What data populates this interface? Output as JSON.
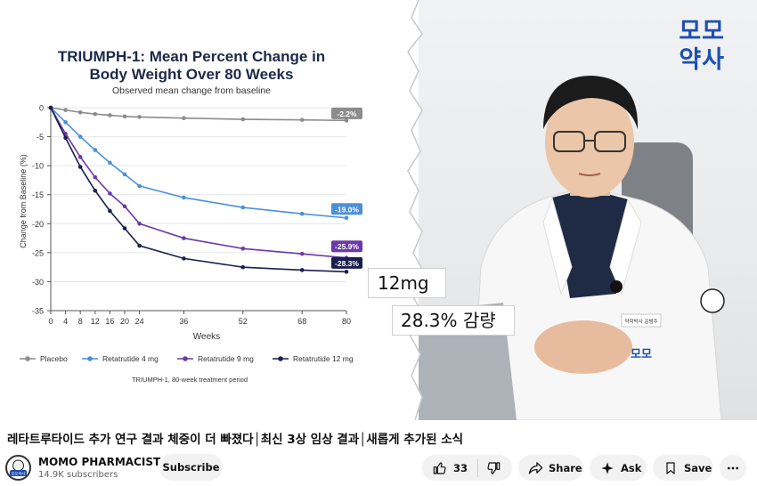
{
  "chart": {
    "title_line1": "TRIUMPH-1: Mean Percent Change in",
    "title_line2": "Body Weight Over 80 Weeks",
    "subtitle": "Observed mean change from baseline",
    "footnote": "TRIUMPH-1, 80-week treatment period"
  },
  "chart_data": {
    "type": "line",
    "title": "TRIUMPH-1: Mean Percent Change in Body Weight Over 80 Weeks",
    "subtitle": "Observed mean change from baseline",
    "xlabel": "Weeks",
    "ylabel": "Change from Baseline (%)",
    "x": [
      0,
      4,
      8,
      12,
      16,
      20,
      24,
      36,
      52,
      68,
      80
    ],
    "xticks": [
      "0",
      "4",
      "8",
      "12",
      "16",
      "20",
      "24",
      "36",
      "52",
      "68",
      "80"
    ],
    "yticks": [
      "0",
      "-5",
      "-10",
      "-15",
      "-20",
      "-25",
      "-30",
      "-35"
    ],
    "ylim": [
      -35,
      0
    ],
    "xlim": [
      0,
      80
    ],
    "grid": true,
    "legend_position": "bottom",
    "series": [
      {
        "name": "Placebo",
        "color": "#8c8c8c",
        "values": [
          0,
          -0.4,
          -0.8,
          -1.1,
          -1.3,
          -1.5,
          -1.6,
          -1.8,
          -2.0,
          -2.1,
          -2.2
        ],
        "end_label": "-2.2%"
      },
      {
        "name": "Retatrutide 4 mg",
        "color": "#4a90d9",
        "values": [
          0,
          -2.5,
          -5.0,
          -7.3,
          -9.5,
          -11.5,
          -13.5,
          -15.5,
          -17.2,
          -18.3,
          -19.0
        ],
        "end_label": "-19.0%"
      },
      {
        "name": "Retatrutide 9 mg",
        "color": "#6a3aa8",
        "values": [
          0,
          -4.5,
          -8.5,
          -12.0,
          -14.8,
          -17.0,
          -20.0,
          -22.5,
          -24.3,
          -25.2,
          -25.9
        ],
        "end_label": "-25.9%"
      },
      {
        "name": "Retatrutide 12 mg",
        "color": "#1a1f4e",
        "values": [
          0,
          -5.2,
          -10.2,
          -14.3,
          -17.8,
          -20.8,
          -23.8,
          -26.0,
          -27.5,
          -28.0,
          -28.3
        ],
        "end_label": "-28.3%"
      }
    ]
  },
  "overlay": {
    "dose_text": "12mg",
    "loss_text": "28.3% 감량"
  },
  "brand": {
    "line1": "모모",
    "line2": "약사"
  },
  "doctor": {
    "badge_text": "약학박사 김범주",
    "coat_logo": "모모"
  },
  "video": {
    "title": "레타트루타이드 추가 연구 결과 체중이 더 빠졌다│최신 3상 임상 결과│새롭게 추가된 소식"
  },
  "channel": {
    "name": "MOMO PHARMACIST",
    "subscribers": "14.9K subscribers",
    "subscribe_label": "Subscribe",
    "avatar_text": "모모약사"
  },
  "actions": {
    "like_count": "33",
    "share_label": "Share",
    "ask_label": "Ask",
    "save_label": "Save"
  }
}
